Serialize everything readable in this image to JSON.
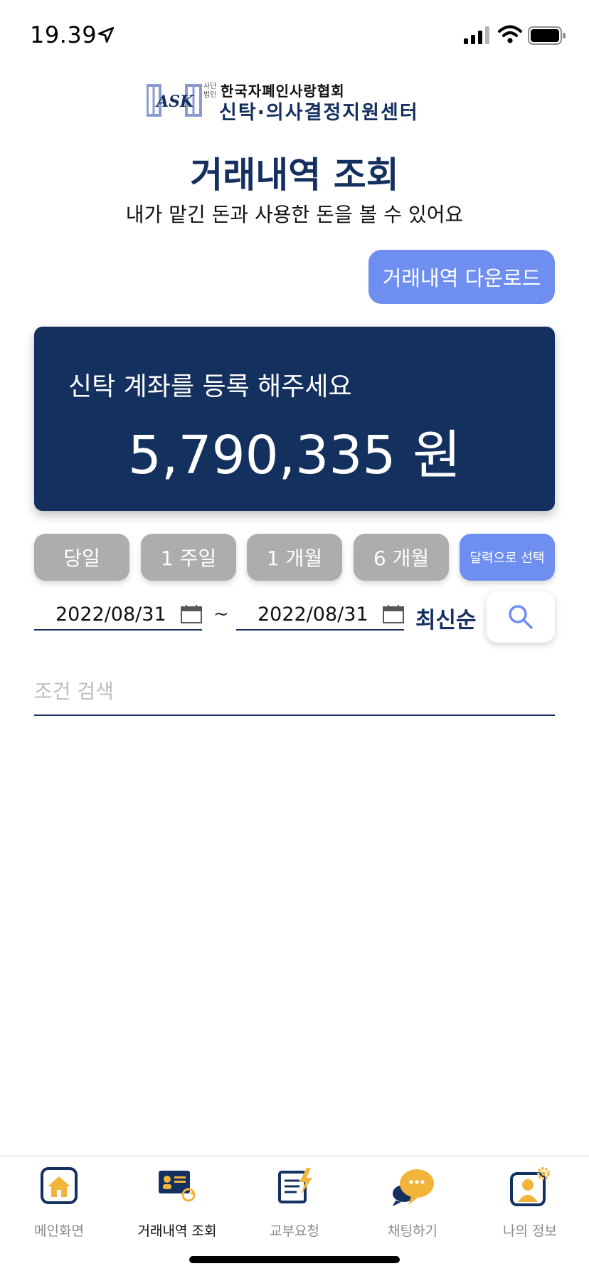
{
  "status_bar": {
    "time": "19.39"
  },
  "logo": {
    "mark_text": "ASK",
    "small_top": "사단",
    "small_bottom": "법인",
    "line1": "한국자폐인사랑협회",
    "line2": "신탁·의사결정지원센터"
  },
  "page": {
    "title": "거래내역 조회",
    "subtitle": "내가 맡긴 돈과 사용한 돈을 볼 수 있어요"
  },
  "download_button": {
    "label": "거래내역 다운로드"
  },
  "balance_card": {
    "label": "신탁 계좌를 등록 해주세요",
    "amount": "5,790,335 원"
  },
  "period_filters": {
    "today": "당일",
    "week": "1 주일",
    "month": "1 개월",
    "six_months": "6 개월",
    "calendar": "달력으로 선택",
    "selected": "달력으로 선택"
  },
  "date_range": {
    "from": "2022/08/31",
    "separator": "~",
    "to": "2022/08/31",
    "sort": "최신순"
  },
  "search": {
    "placeholder": "조건 검색",
    "value": ""
  },
  "tab_bar": {
    "home": "메인화면",
    "history": "거래내역 조회",
    "request": "교부요청",
    "chat": "채팅하기",
    "profile": "나의 정보",
    "active": "거래내역 조회"
  },
  "colors": {
    "primary": "#14305f",
    "accent": "#6e8ff0",
    "inactive_button": "#adadad",
    "icon_yellow": "#f2b53a"
  },
  "icons": {
    "location": "location-arrow-icon",
    "signal": "cellular-signal-icon",
    "wifi": "wifi-icon",
    "battery": "battery-icon",
    "calendar": "calendar-icon",
    "search": "search-icon",
    "home": "home-icon",
    "history": "card-refresh-icon",
    "request": "document-lightning-icon",
    "chat": "chat-bubble-icon",
    "profile": "user-gear-icon"
  }
}
